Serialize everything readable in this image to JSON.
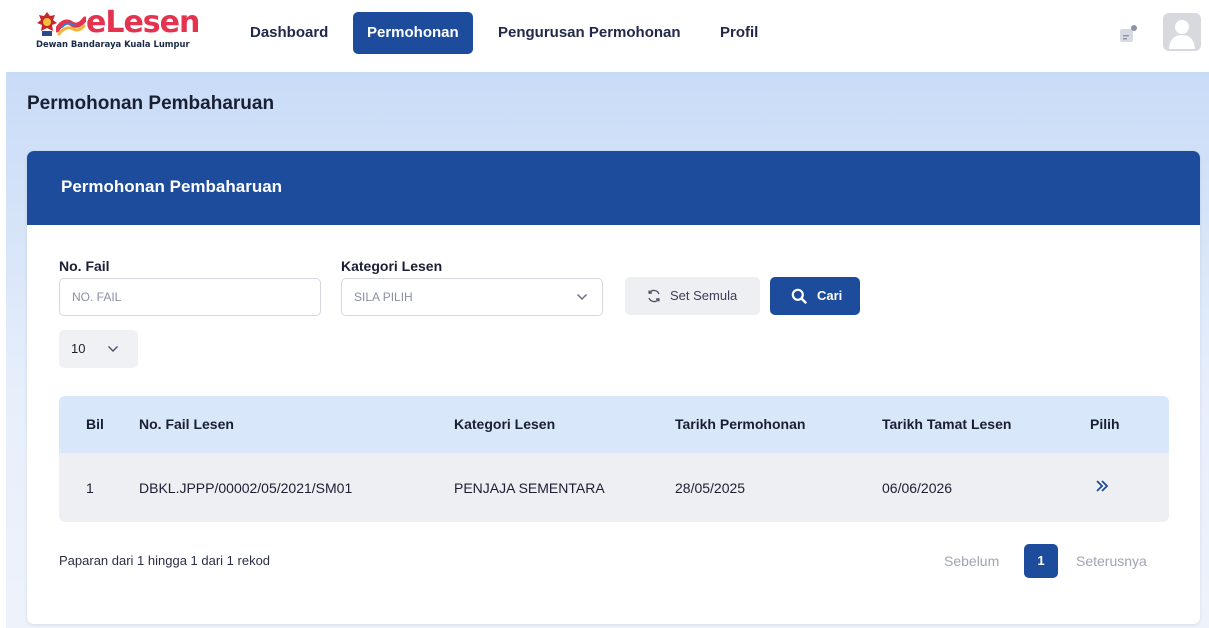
{
  "app": {
    "name": "eLesen",
    "subtitle": "Dewan Bandaraya Kuala Lumpur"
  },
  "nav": {
    "items": [
      {
        "label": "Dashboard",
        "active": false
      },
      {
        "label": "Permohonan",
        "active": true
      },
      {
        "label": "Pengurusan Permohonan",
        "active": false
      },
      {
        "label": "Profil",
        "active": false
      }
    ]
  },
  "header_icons": [
    "notification-icon",
    "user-avatar-icon"
  ],
  "page": {
    "title": "Permohonan Pembaharuan"
  },
  "card": {
    "title": "Permohonan Pembaharuan"
  },
  "filters": {
    "file_no_label": "No. Fail",
    "file_no_placeholder": "NO. FAIL",
    "category_label": "Kategori Lesen",
    "category_value": "SILA PILIH",
    "reset_label": "Set Semula",
    "search_label": "Cari"
  },
  "page_size": "10",
  "table": {
    "headers": [
      "Bil",
      "No. Fail Lesen",
      "Kategori Lesen",
      "Tarikh Permohonan",
      "Tarikh Tamat Lesen",
      "Pilih"
    ],
    "rows": [
      {
        "bil": "1",
        "file_no": "DBKL.JPPP/00002/05/2021/SM01",
        "category": "PENJAJA SEMENTARA",
        "applied": "28/05/2025",
        "expiry": "06/06/2026"
      }
    ]
  },
  "pagination": {
    "info": "Paparan dari 1 hingga 1 dari 1 rekod",
    "prev": "Sebelum",
    "current": "1",
    "next": "Seterusnya"
  },
  "colors": {
    "primary": "#1c4c9b",
    "brand_red": "#e5334f",
    "header_row": "#d9e7fa"
  }
}
